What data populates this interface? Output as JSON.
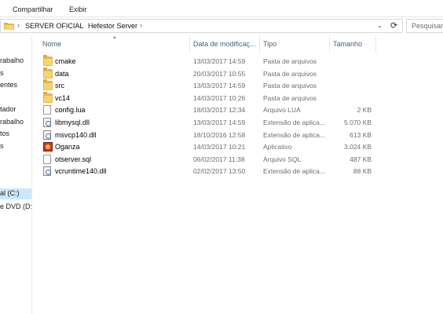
{
  "ribbon": {
    "tabs": [
      "Compartilhar",
      "Exibir"
    ]
  },
  "address": {
    "crumbs": [
      "SERVER OFICIAL",
      "Hefestor Server"
    ],
    "separator": "›",
    "dropdown": "⌄",
    "refresh": "⟳"
  },
  "search": {
    "placeholder": "Pesquisar He"
  },
  "nav": {
    "items": [
      "rabalho",
      "s",
      "entes",
      "tador",
      "rabalho",
      "tos",
      "s",
      "al (C:)",
      "e DVD (D:)"
    ]
  },
  "columns": {
    "name": "Nome",
    "date": "Data de modificaç...",
    "type": "Tipo",
    "size": "Tamanho"
  },
  "files": [
    {
      "name": "cmake",
      "date": "13/03/2017 14:59",
      "type": "Pasta de arquivos",
      "size": "",
      "icon": "folder-icon"
    },
    {
      "name": "data",
      "date": "20/03/2017 10:55",
      "type": "Pasta de arquivos",
      "size": "",
      "icon": "folder-icon"
    },
    {
      "name": "src",
      "date": "13/03/2017 14:59",
      "type": "Pasta de arquivos",
      "size": "",
      "icon": "folder-icon"
    },
    {
      "name": "vc14",
      "date": "14/03/2017 10:26",
      "type": "Pasta de arquivos",
      "size": "",
      "icon": "folder-icon"
    },
    {
      "name": "config.lua",
      "date": "18/03/2017 12:34",
      "type": "Arquivo LUA",
      "size": "2 KB",
      "icon": "file-icon"
    },
    {
      "name": "libmysql.dll",
      "date": "13/03/2017 14:59",
      "type": "Extensão de aplica...",
      "size": "5.070 KB",
      "icon": "dll-icon"
    },
    {
      "name": "msvcp140.dll",
      "date": "18/10/2016 12:58",
      "type": "Extensão de aplica...",
      "size": "613 KB",
      "icon": "dll-icon"
    },
    {
      "name": "Oganza",
      "date": "14/03/2017 10:21",
      "type": "Aplicativo",
      "size": "3.024 KB",
      "icon": "app-icon"
    },
    {
      "name": "otserver.sql",
      "date": "06/02/2017 11:38",
      "type": "Arquivo SQL",
      "size": "487 KB",
      "icon": "file-icon"
    },
    {
      "name": "vcruntime140.dll",
      "date": "02/02/2017 13:50",
      "type": "Extensão de aplica...",
      "size": "88 KB",
      "icon": "dll-icon"
    }
  ]
}
